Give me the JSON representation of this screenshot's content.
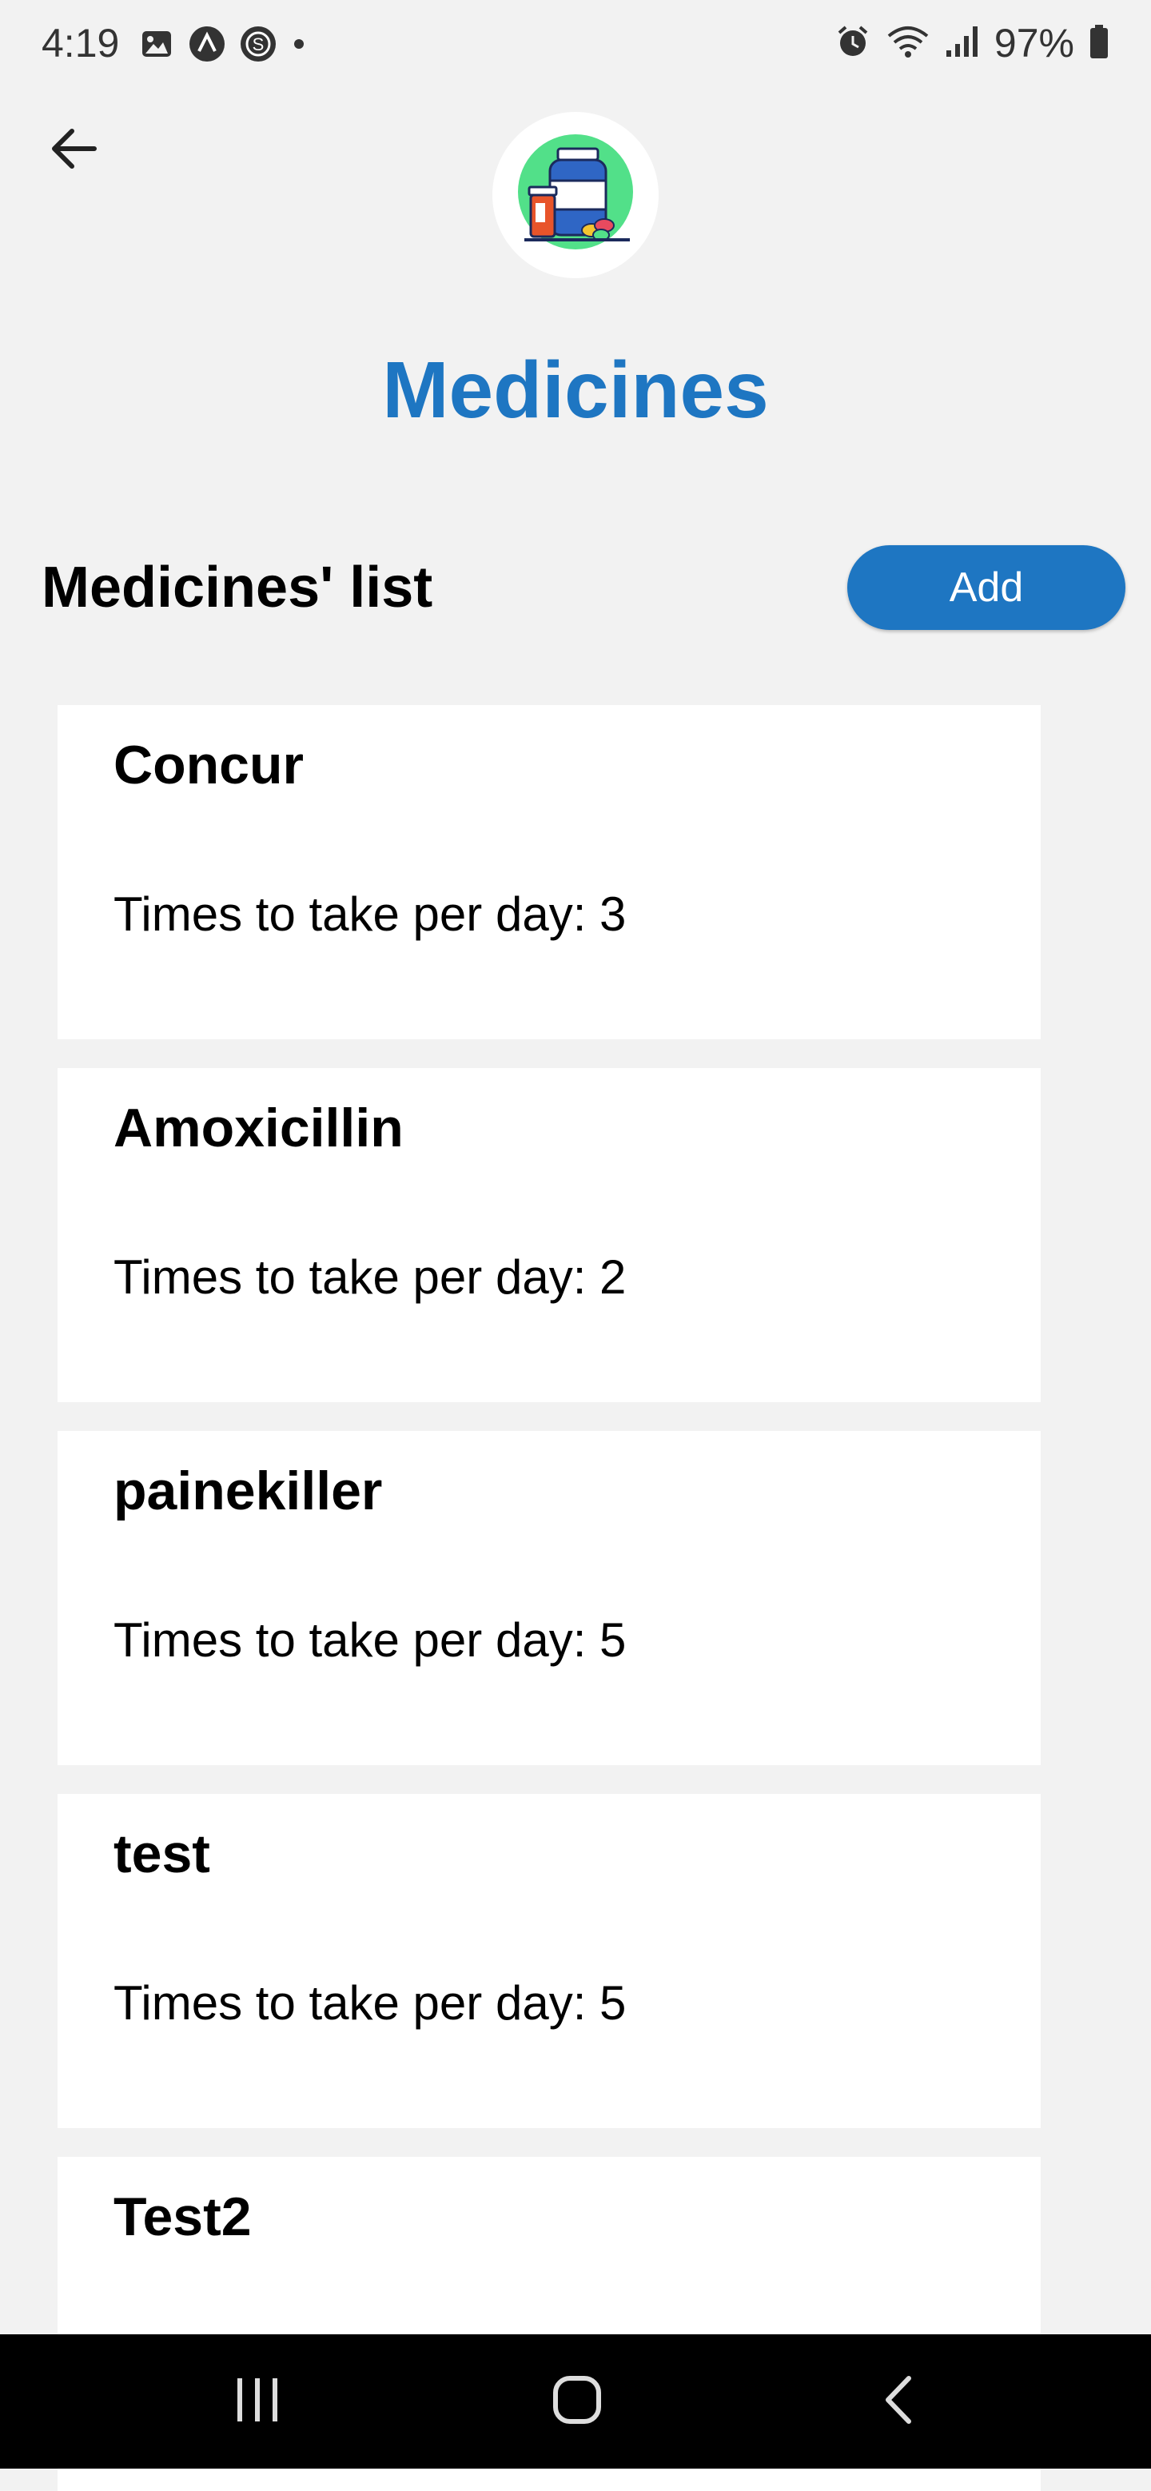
{
  "status_bar": {
    "time": "4:19",
    "battery": "97%",
    "left_icons": [
      "gallery-icon",
      "app-icon",
      "skype-icon",
      "dot-icon"
    ],
    "right_icons": [
      "alarm-icon",
      "wifi-icon",
      "signal-icon",
      "battery-icon"
    ]
  },
  "header": {
    "back_icon": "arrow-left-icon",
    "logo_icon": "medicine-bottle-icon",
    "title": "Medicines"
  },
  "list_section": {
    "title": "Medicines' list",
    "add_label": "Add"
  },
  "medicines": [
    {
      "name": "Concur",
      "times_text": "Times to take per day: 3"
    },
    {
      "name": "Amoxicillin",
      "times_text": "Times to take per day: 2"
    },
    {
      "name": "painekiller",
      "times_text": "Times to take per day: 5"
    },
    {
      "name": "test",
      "times_text": "Times to take per day: 5"
    },
    {
      "name": "Test2",
      "times_text": ""
    }
  ],
  "nav_bar": {
    "recent_icon": "recent-apps-icon",
    "home_icon": "home-icon",
    "back_icon": "back-chevron-icon"
  },
  "colors": {
    "accent": "#1e76c2",
    "background": "#f2f2f2",
    "card": "#ffffff"
  }
}
